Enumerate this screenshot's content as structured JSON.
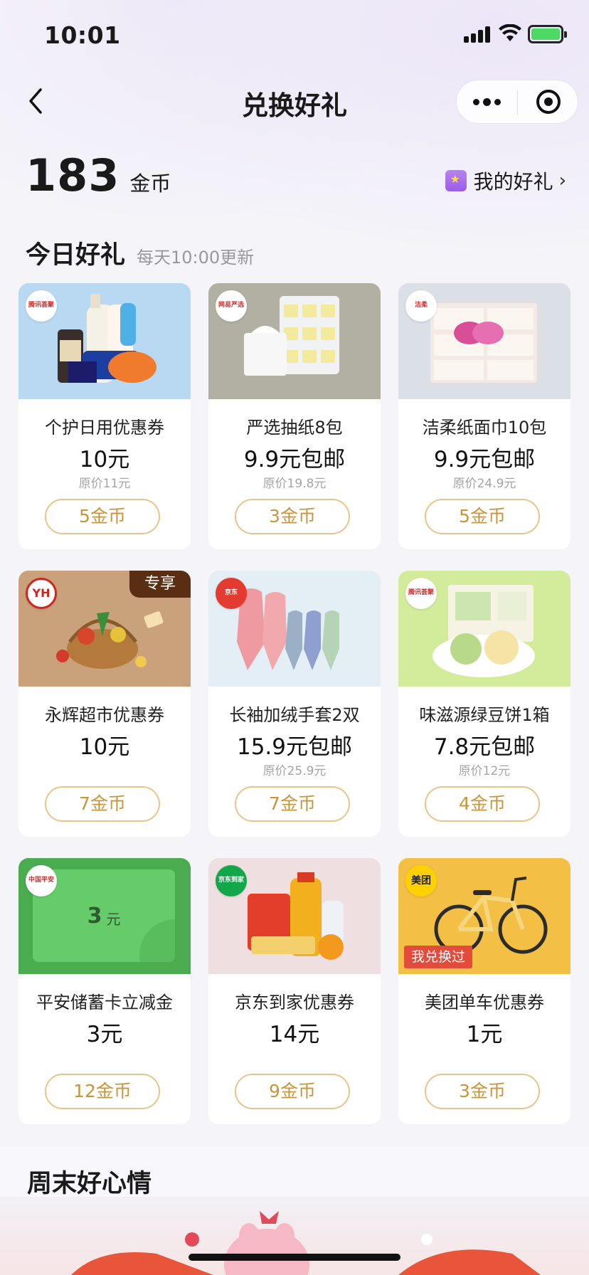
{
  "status_bar": {
    "time": "10:01"
  },
  "nav": {
    "title": "兑换好礼"
  },
  "coins": {
    "amount": "183",
    "unit": "金币"
  },
  "my_gifts": {
    "label": "我的好礼",
    "chevron": "›"
  },
  "today": {
    "title": "今日好礼",
    "subtitle": "每天10:00更新"
  },
  "products": [
    {
      "name": "个护日用优惠券",
      "price": "10元",
      "original": "原价11元",
      "button": "5金币",
      "logo": "腾讯荟聚",
      "bg": "#b9d9f3"
    },
    {
      "name": "严选抽纸8包",
      "price": "9.9元包邮",
      "original": "原价19.8元",
      "button": "3金币",
      "logo": "网易严选",
      "bg": "#b2b0a2"
    },
    {
      "name": "洁柔纸面巾10包",
      "price": "9.9元包邮",
      "original": "原价24.9元",
      "button": "5金币",
      "logo": "洁柔",
      "bg": "#dbdfe6"
    },
    {
      "name": "永辉超市优惠券",
      "price": "10元",
      "original": "",
      "button": "7金币",
      "logo": "YH",
      "badge": "专享",
      "bg": "#c9a27c"
    },
    {
      "name": "长袖加绒手套2双",
      "price": "15.9元包邮",
      "original": "原价25.9元",
      "button": "7金币",
      "logo": "京东",
      "bg": "#e4eef5"
    },
    {
      "name": "味滋源绿豆饼1箱",
      "price": "7.8元包邮",
      "original": "原价12元",
      "button": "4金币",
      "logo": "腾讯荟聚",
      "bg": "#d2ec9c"
    },
    {
      "name": "平安储蓄卡立减金",
      "price": "3元",
      "original": "",
      "button": "12金币",
      "logo": "中国平安",
      "bg": "#4aab4f",
      "card_text": "3",
      "card_unit": "元"
    },
    {
      "name": "京东到家优惠券",
      "price": "14元",
      "original": "",
      "button": "9金币",
      "logo": "京东到家",
      "bg": "#efdfe1"
    },
    {
      "name": "美团单车优惠券",
      "price": "1元",
      "original": "",
      "button": "3金币",
      "logo": "美团",
      "badge_used": "我兑换过",
      "bg": "#f4bf45"
    }
  ],
  "weekend": {
    "title": "周末好心情"
  }
}
